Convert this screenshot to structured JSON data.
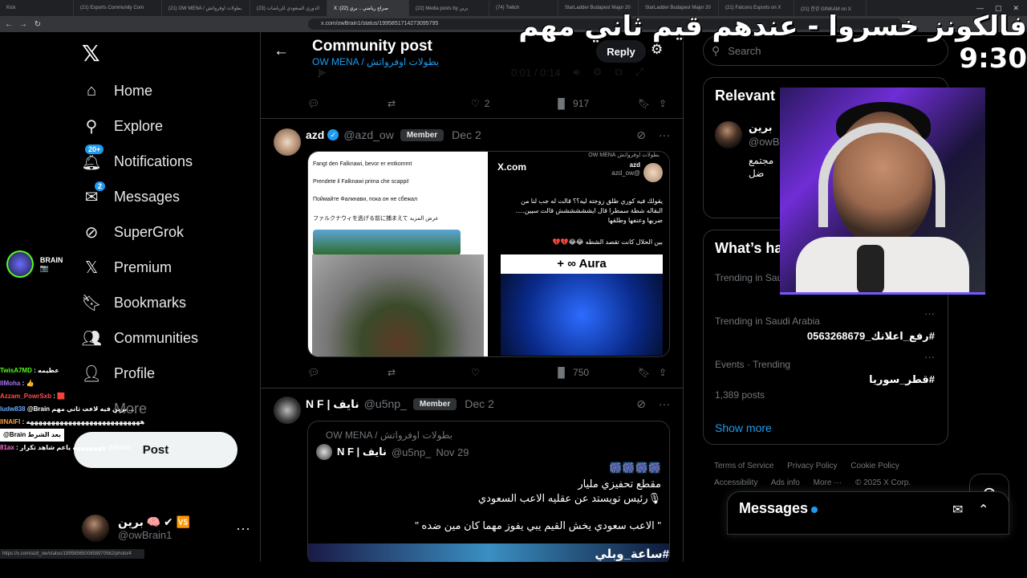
{
  "browser": {
    "tabs": [
      "Kick",
      "(21) Esports Community Corn",
      "(21) OW MENA / بطولات اوفرواتش",
      "الدوري السعودي للرياضات (23)",
      "X :صراع رياضي .. بري (22)",
      "(22) Media posts by برين",
      "(74) Twitch",
      "StarLadder Budapest Major 20",
      "StarLadder Budapest Major 20",
      "(21) Falcons Esports on X",
      "(21) 한강 GINKAM on X"
    ],
    "active_tab_index": 4,
    "url": "x.com/owBrain1/status/1995851714273095795",
    "status_url": "https://x.com/azd_ow/status/1995856500858970562/photo/4"
  },
  "overlay_title": "فالكونز خسروا - عندهم قيم ثاني مهم 9:30",
  "sidebar": {
    "nav": [
      {
        "label": "Home",
        "icon": "home-icon"
      },
      {
        "label": "Explore",
        "icon": "search-icon"
      },
      {
        "label": "Notifications",
        "icon": "bell-icon",
        "badge": "20+"
      },
      {
        "label": "Messages",
        "icon": "envelope-icon",
        "badge": "2"
      },
      {
        "label": "SuperGrok",
        "icon": "grok-icon"
      },
      {
        "label": "Premium",
        "icon": "x-logo-icon"
      },
      {
        "label": "Bookmarks",
        "icon": "bookmark-icon"
      },
      {
        "label": "Communities",
        "icon": "communities-icon"
      },
      {
        "label": "Profile",
        "icon": "person-icon"
      },
      {
        "label": "More",
        "icon": "more-circle-icon"
      }
    ],
    "post_button": "Post",
    "account": {
      "name": "برين 🧠 ✔ 🆚",
      "handle": "@owBrain1"
    }
  },
  "stream_chat": {
    "streamer": "BRAIN 📷",
    "lines": [
      {
        "user": "TwisA7MD",
        "text": ": عظيمه"
      },
      {
        "user": "IlMoha",
        "text": ": 👍"
      },
      {
        "user": "Azzam_PowrSxb",
        "text": ": 🟥"
      },
      {
        "user": "ludw838",
        "text": "@Brain برين فيه لاعب ثاني مهم ..."
      },
      {
        "user": "IINAIFI",
        "text": ": هههههههههههههههههههههههههههه"
      },
      {
        "user": "81ax",
        "text": ": هههههههه ياعم شاهد تكرار @Brain"
      }
    ],
    "reply_bubble": "@Brain بعد الشرط"
  },
  "center": {
    "title": "Community post",
    "subtitle": "OW MENA / بطولات اوفرواتش",
    "reply_button": "Reply",
    "video": {
      "time": "0:01 / 0:14"
    },
    "post1_actions": {
      "likes": "2",
      "views": "917"
    },
    "post2": {
      "name": "azd",
      "handle": "@azd_ow",
      "badge": "Member",
      "date": "Dec 2",
      "tile_a_lines": [
        "Fangt den Falknawi, bevor er entkommt",
        "Prendete il Falknawi prima che scappi!",
        "Поймайте Фалкнави, пока он не сбежал",
        "ファルクナウィを逃げる前に捕まえて عرض المزيد"
      ],
      "tile_b": {
        "brand": "X.com",
        "community": "بطولات اوفرواتش OW MENA",
        "name": "azd",
        "handle": "@azd_ow",
        "text": "يقولك فيه كوري طلق زوجته ليه؟؟ قالت له جب لنا من البقاله شطة سمطرا قال ايشششششش قالت سيين..... ضربها وعنفها وطلقها",
        "footer": "بين الحلال كانت تقصد الشطه 😂😂💔💔",
        "aura": "+ ∞ Aura"
      },
      "views": "750"
    },
    "post3": {
      "name": "N F | نايف",
      "handle": "@u5np_",
      "badge": "Member",
      "date": "Dec 2",
      "quote": {
        "community": "OW MENA / بطولات اوفرواتش",
        "name": "N F | نايف",
        "handle": "@u5np_",
        "date": "Nov 29",
        "lines": [
          "🎆🎆🎆🎆",
          "مقطع تحفيزي مليار",
          "🎙رئيس تويستد عن عقليه الاعب السعودي",
          "\" الاعب سعودي يخش القيم يبي يفوز مهما كان مين ضده \""
        ],
        "media_label": "#ساعة_وبلي"
      }
    }
  },
  "right": {
    "search_placeholder": "Search",
    "relevant_title": "Relevant people",
    "relevant_person": {
      "name": "برين",
      "handle": "@owBrain1",
      "bio": [
        "مجتمع",
        "ضل"
      ]
    },
    "trends_title": "What’s happening",
    "trends": [
      {
        "meta": "Trending in Saudi Arabia",
        "name": ""
      },
      {
        "meta": "Trending in Saudi Arabia",
        "name": "#رفع_اعلانك_0563268679"
      },
      {
        "meta": "Events · Trending",
        "name": "#قطر_سوريا",
        "posts": "1,389 posts"
      }
    ],
    "show_more": "Show more",
    "footer": [
      "Terms of Service",
      "Privacy Policy",
      "Cookie Policy",
      "Accessibility",
      "Ads info",
      "More ···",
      "© 2025 X Corp."
    ]
  },
  "messages_dock": {
    "title": "Messages"
  }
}
